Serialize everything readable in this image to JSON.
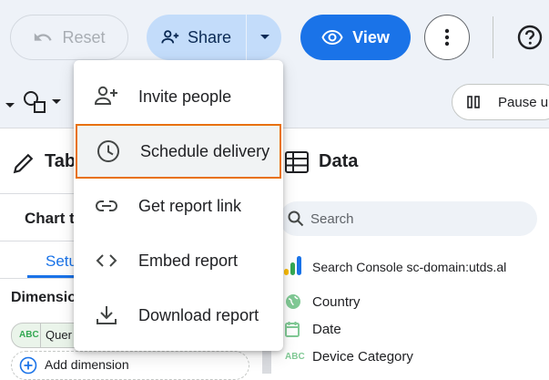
{
  "header": {
    "reset_label": "Reset",
    "share_label": "Share",
    "view_label": "View"
  },
  "toolbar": {
    "pause_label": "Pause up"
  },
  "left_panel": {
    "title": "Tab",
    "chart_type_label": "Chart ty",
    "setup_tab": "Setu",
    "dimension_label": "Dimensio",
    "chip_prefix": "ABC",
    "chip_label": "Quer",
    "add_dimension": "Add dimension"
  },
  "data_panel": {
    "title": "Data",
    "search_placeholder": "Search",
    "source_name": "Search Console sc-domain:utds.al",
    "fields": [
      {
        "label": "Country",
        "icon": "globe-icon"
      },
      {
        "label": "Date",
        "icon": "calendar-icon"
      },
      {
        "label": "Device Category",
        "icon": "abc-icon"
      }
    ]
  },
  "share_menu": {
    "items": [
      {
        "label": "Invite people",
        "icon": "person-add-icon"
      },
      {
        "label": "Schedule delivery",
        "icon": "clock-icon",
        "highlighted": true
      },
      {
        "label": "Get report link",
        "icon": "link-icon"
      },
      {
        "label": "Embed report",
        "icon": "code-icon"
      },
      {
        "label": "Download report",
        "icon": "download-icon"
      }
    ]
  },
  "colors": {
    "accent": "#1a73e8",
    "share_bg": "#c3dcfa",
    "highlight_border": "#e8710a",
    "field_green": "#34a853"
  }
}
